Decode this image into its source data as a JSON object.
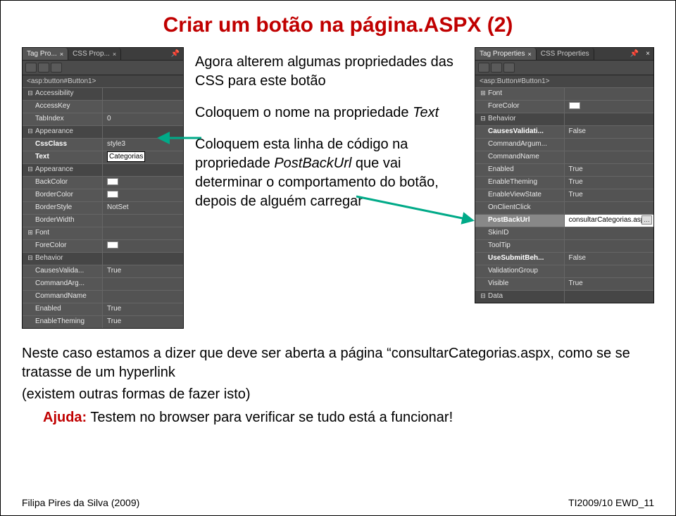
{
  "title": "Criar um botão na página.ASPX (2)",
  "panel_left": {
    "tabs": [
      {
        "label": "Tag Pro...",
        "closable": true
      },
      {
        "label": "CSS Prop...",
        "closable": true
      }
    ],
    "element": "<asp:button#Button1>",
    "rows": [
      {
        "type": "cat",
        "name": "Accessibility",
        "exp": "−"
      },
      {
        "type": "prop",
        "name": "AccessKey",
        "val": ""
      },
      {
        "type": "prop",
        "name": "TabIndex",
        "val": "0"
      },
      {
        "type": "cat",
        "name": "Appearance",
        "exp": "−"
      },
      {
        "type": "prop",
        "name": "CssClass",
        "val": "style3",
        "bold": true
      },
      {
        "type": "prop",
        "name": "Text",
        "val": "Categorias",
        "bold": true,
        "editing": true
      },
      {
        "type": "cat",
        "name": "Appearance",
        "exp": "−"
      },
      {
        "type": "prop",
        "name": "BackColor",
        "val": "",
        "swatch": true
      },
      {
        "type": "prop",
        "name": "BorderColor",
        "val": "",
        "swatch": true
      },
      {
        "type": "prop",
        "name": "BorderStyle",
        "val": "NotSet"
      },
      {
        "type": "prop",
        "name": "BorderWidth",
        "val": ""
      },
      {
        "type": "prop",
        "name": "Font",
        "val": "",
        "exp": "+"
      },
      {
        "type": "prop",
        "name": "ForeColor",
        "val": "",
        "swatch": true
      },
      {
        "type": "cat",
        "name": "Behavior",
        "exp": "−"
      },
      {
        "type": "prop",
        "name": "CausesValida...",
        "val": "True"
      },
      {
        "type": "prop",
        "name": "CommandArg...",
        "val": ""
      },
      {
        "type": "prop",
        "name": "CommandName",
        "val": ""
      },
      {
        "type": "prop",
        "name": "Enabled",
        "val": "True"
      },
      {
        "type": "prop",
        "name": "EnableTheming",
        "val": "True"
      }
    ]
  },
  "mid": {
    "p1a": "Agora alterem algumas propriedades das CSS para este botão",
    "p2a": "Coloquem o nome na propriedade ",
    "p2b": "Text",
    "p3a": "Coloquem esta linha de código na propriedade ",
    "p3b": "PostBackUrl",
    "p3c": " que vai determinar o comportamento do botão, depois de alguém carregar"
  },
  "panel_right": {
    "tabs": [
      {
        "label": "Tag Properties",
        "closable": true
      },
      {
        "label": "CSS Properties",
        "closable": false
      }
    ],
    "element": "<asp:Button#Button1>",
    "rows": [
      {
        "type": "prop",
        "name": "Font",
        "val": "",
        "exp": "+"
      },
      {
        "type": "prop",
        "name": "ForeColor",
        "val": "",
        "swatch": true
      },
      {
        "type": "cat",
        "name": "Behavior",
        "exp": "−"
      },
      {
        "type": "prop",
        "name": "CausesValidati...",
        "val": "False",
        "bold": true
      },
      {
        "type": "prop",
        "name": "CommandArgum...",
        "val": ""
      },
      {
        "type": "prop",
        "name": "CommandName",
        "val": ""
      },
      {
        "type": "prop",
        "name": "Enabled",
        "val": "True"
      },
      {
        "type": "prop",
        "name": "EnableTheming",
        "val": "True"
      },
      {
        "type": "prop",
        "name": "EnableViewState",
        "val": "True"
      },
      {
        "type": "prop",
        "name": "OnClientClick",
        "val": ""
      },
      {
        "type": "prop",
        "name": "PostBackUrl",
        "val": "consultarCategorias.aspx",
        "bold": true,
        "selected": true,
        "dots": true
      },
      {
        "type": "prop",
        "name": "SkinID",
        "val": ""
      },
      {
        "type": "prop",
        "name": "ToolTip",
        "val": ""
      },
      {
        "type": "prop",
        "name": "UseSubmitBeh...",
        "val": "False",
        "bold": true
      },
      {
        "type": "prop",
        "name": "ValidationGroup",
        "val": ""
      },
      {
        "type": "prop",
        "name": "Visible",
        "val": "True"
      },
      {
        "type": "cat",
        "name": "Data",
        "exp": "−"
      }
    ]
  },
  "bottom": {
    "line1a": "Neste caso estamos a dizer que deve ser aberta a página “consultarCategorias.aspx, como se se tratasse de um ",
    "line1b": "hyperlink",
    "line2": "(existem outras formas de fazer isto)",
    "ajuda_label": "Ajuda:",
    "ajuda_text": " Testem no ",
    "ajuda_em": "browser",
    "ajuda_tail": " para verificar se tudo está a funcionar!"
  },
  "footer": {
    "left": "Filipa Pires da Silva (2009)",
    "right": "TI2009/10 EWD_11"
  }
}
